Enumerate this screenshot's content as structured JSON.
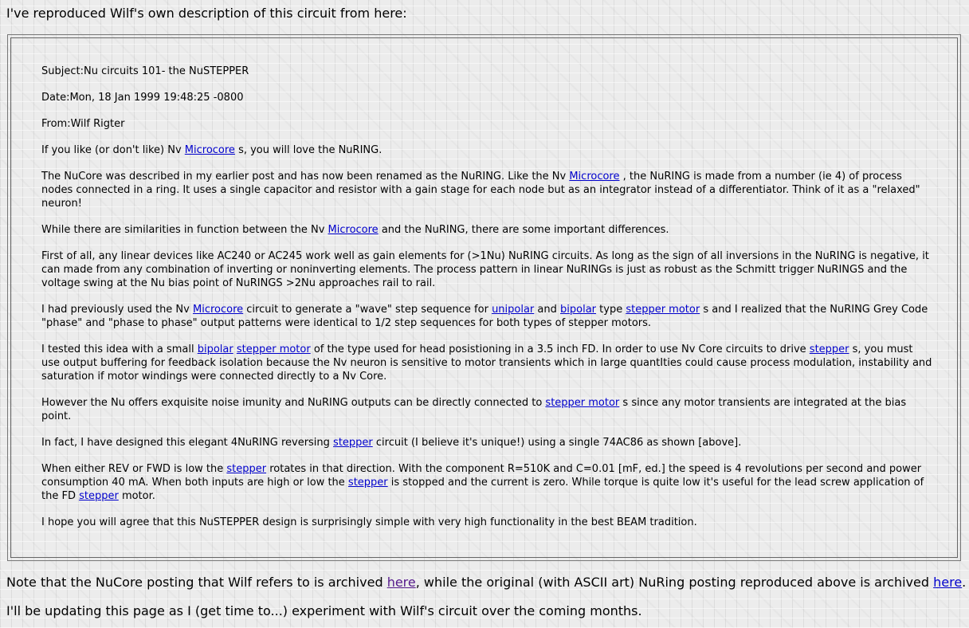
{
  "intro": "I've reproduced Wilf's own description of this circuit from here:",
  "email": {
    "subject": "Subject:Nu circuits 101- the NuSTEPPER",
    "date": "Date:Mon, 18 Jan 1999 19:48:25 -0800",
    "from": "From:Wilf Rigter",
    "p1": {
      "a": "If you like (or don't like) Nv ",
      "link1": "Microcore",
      "b": " s, you will love the NuRING."
    },
    "p2": {
      "a": "The NuCore was described in my earlier post and has now been renamed as the NuRING. Like the Nv ",
      "link1": "Microcore",
      "b": " , the NuRING is made from a number (ie 4) of process nodes connected in a ring. It uses a single capacitor and resistor with a gain stage for each node but as an integrator instead of a differentiator. Think of it as a \"relaxed\" neuron!"
    },
    "p3": {
      "a": "While there are similarities in function between the Nv ",
      "link1": "Microcore",
      "b": " and the NuRING, there are some important differences."
    },
    "p4": "First of all, any linear devices like AC240 or AC245 work well as gain elements for (>1Nu) NuRING circuits. As long as the sign of all inversions in the NuRING is negative, it can made from any combination of inverting or noninverting elements. The process pattern in linear NuRINGs is just as robust as the Schmitt trigger NuRINGS and the voltage swing at the Nu bias point of NuRINGS >2Nu approaches rail to rail.",
    "p5": {
      "a": "I had previously used the Nv ",
      "link1": "Microcore",
      "b": " circuit to generate a \"wave\" step sequence for ",
      "link2": "unipolar",
      "c": " and ",
      "link3": "bipolar",
      "d": " type ",
      "link4": "stepper motor",
      "e": " s and I realized that the NuRING Grey Code \"phase\" and \"phase to phase\" output patterns were identical to 1/2 step sequences for both types of stepper motors."
    },
    "p6": {
      "a": "I tested this idea with a small ",
      "link1": "bipolar",
      "b": " ",
      "link2": "stepper motor",
      "c": " of the type used for head posistioning in a 3.5 inch FD. In order to use Nv Core circuits to drive ",
      "link3": "stepper",
      "d": " s, you must use output buffering for feedback isolation because the Nv neuron is sensitive to motor transients which in large quantIties could cause process modulation, instability and saturation if motor windings were connected directly to a Nv Core."
    },
    "p7": {
      "a": "However the Nu offers exquisite noise imunity and NuRING outputs can be directly connected to ",
      "link1": "stepper motor",
      "b": " s since any motor transients are integrated at the bias point."
    },
    "p8": {
      "a": "In fact, I have designed this elegant 4NuRING reversing ",
      "link1": "stepper",
      "b": " circuit (I believe it's unique!) using a single 74AC86 as shown [above]."
    },
    "p9": {
      "a": "When either REV or FWD is low the ",
      "link1": "stepper",
      "b": " rotates in that direction. With the component R=510K and C=0.01 [mF, ed.] the speed is 4 revolutions per second and power consumption 40 mA. When both inputs are high or low the ",
      "link2": "stepper",
      "c": " is stopped and the current is zero. While torque is quite low it's useful for the lead screw application of the FD ",
      "link3": "stepper",
      "d": " motor."
    },
    "p10": "I hope you will agree that this NuSTEPPER design is surprisingly simple with very high functionality in the best BEAM tradition."
  },
  "outro1": {
    "a": "Note that the NuCore posting that Wilf refers to is archived ",
    "link1": "here",
    "b": ", while the original (with ASCII art) NuRing posting reproduced above is archived ",
    "link2": "here",
    "c": "."
  },
  "outro2": "I'll be updating this page as I (get time to...) experiment with Wilf's circuit over the coming months.",
  "colors": {
    "link": "#0000cc",
    "visited": "#551a8b",
    "background": "#ececec"
  }
}
